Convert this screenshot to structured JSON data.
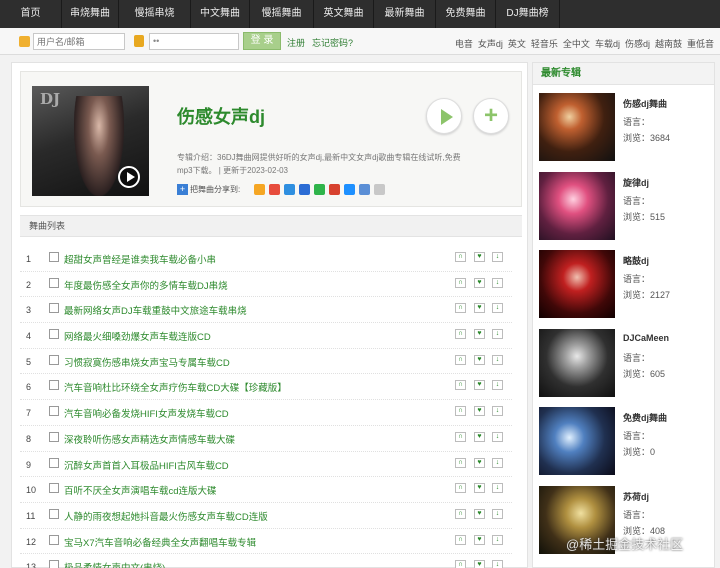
{
  "nav": [
    "首页",
    "串烧舞曲",
    "慢摇串烧",
    "中文舞曲",
    "慢摇舞曲",
    "英文舞曲",
    "最新舞曲",
    "免费舞曲",
    "DJ舞曲榜"
  ],
  "login": {
    "user_placeholder": "用户名/邮箱",
    "pass_value": "••",
    "login_label": "登 录",
    "register": "注册",
    "forgot": "忘记密码?"
  },
  "tags": [
    "电音",
    "女声dj",
    "英文",
    "轻音乐",
    "全中文",
    "车载dj",
    "伤感dj",
    "越南鼓",
    "重低音"
  ],
  "album": {
    "cover_text": "DJ",
    "title": "伤感女声dj",
    "intro_line1": "专辑介绍：36DJ舞曲网提供好听的女声dj,最新中文女声dj歌曲专辑在线试听,免费",
    "intro_line2": "mp3下载。 | 更新于2023-02-03",
    "share_label": "把舞曲分享到:",
    "add_icon": "+"
  },
  "share_colors": [
    "#f5a623",
    "#e74c3c",
    "#2f8fe0",
    "#2b6cd4",
    "#2fb44a",
    "#d7412e",
    "#1e90ff",
    "#5b8fd6",
    "#c8c8c8"
  ],
  "list_header": "舞曲列表",
  "songs": [
    {
      "num": "1",
      "title": "超甜女声曾经是谁卖我车载必备小串"
    },
    {
      "num": "2",
      "title": "年度最伤感全女声你的多情车载DJ串烧"
    },
    {
      "num": "3",
      "title": "最新网络女声DJ车载重鼓中文旅途车载串烧"
    },
    {
      "num": "4",
      "title": "网络最火细嗓劲爆女声车载连版CD"
    },
    {
      "num": "5",
      "title": "习惯寂寞伤感串烧女声宝马专属车载CD"
    },
    {
      "num": "6",
      "title": "汽车音响杜比环绕全女声疗伤车载CD大碟【珍藏版】"
    },
    {
      "num": "7",
      "title": "汽车音响必备发烧HIFI女声发烧车载CD"
    },
    {
      "num": "8",
      "title": "深夜聆听伤感女声精选女声情感车载大碟"
    },
    {
      "num": "9",
      "title": "沉醉女声首首入耳极品HIFI古风车载CD"
    },
    {
      "num": "10",
      "title": "百听不厌全女声演唱车载cd连版大碟"
    },
    {
      "num": "11",
      "title": "人静的雨夜想起她抖音最火伤感女声车载CD连版"
    },
    {
      "num": "12",
      "title": "宝马X7汽车音响必备经典全女声翻唱车载专辑"
    },
    {
      "num": "13",
      "title": "极品柔情女声中文(串烧)"
    }
  ],
  "song_actions": [
    "∩",
    "♥",
    "↓"
  ],
  "right": {
    "header": "最新专辑",
    "lang_label": "语言：",
    "views_prefix": "浏览：",
    "items": [
      {
        "title": "伤感dj舞曲",
        "views": "3684"
      },
      {
        "title": "旋律dj",
        "views": "515"
      },
      {
        "title": "略鼓dj",
        "views": "2127"
      },
      {
        "title": "DJCaMeen",
        "views": "605"
      },
      {
        "title": "免费dj舞曲",
        "views": "0"
      },
      {
        "title": "苏荷dj",
        "views": "408"
      }
    ]
  },
  "watermark": "@稀土掘金技术社区"
}
